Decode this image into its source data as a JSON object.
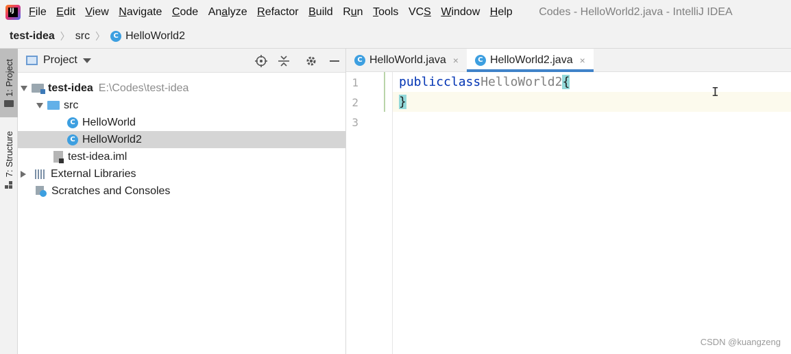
{
  "menubar": {
    "items": [
      {
        "label": "File",
        "mnemonic_index": 0
      },
      {
        "label": "Edit",
        "mnemonic_index": 0
      },
      {
        "label": "View",
        "mnemonic_index": 0
      },
      {
        "label": "Navigate",
        "mnemonic_index": 0
      },
      {
        "label": "Code",
        "mnemonic_index": 0
      },
      {
        "label": "Analyze",
        "mnemonic_index": 2
      },
      {
        "label": "Refactor",
        "mnemonic_index": 0
      },
      {
        "label": "Build",
        "mnemonic_index": 0
      },
      {
        "label": "Run",
        "mnemonic_index": 1
      },
      {
        "label": "Tools",
        "mnemonic_index": 0
      },
      {
        "label": "VCS",
        "mnemonic_index": 2
      },
      {
        "label": "Window",
        "mnemonic_index": 0
      },
      {
        "label": "Help",
        "mnemonic_index": 0
      }
    ],
    "window_title": "Codes - HelloWorld2.java - IntelliJ IDEA"
  },
  "breadcrumb": {
    "project": "test-idea",
    "folder": "src",
    "file": "HelloWorld2",
    "file_icon_letter": "C"
  },
  "left_strip": {
    "project_tab": "1: Project",
    "structure_tab": "7: Structure"
  },
  "project_panel": {
    "title": "Project",
    "tree": {
      "root_label": "test-idea",
      "root_path": "E:\\Codes\\test-idea",
      "src_label": "src",
      "file1_label": "HelloWorld",
      "file2_label": "HelloWorld2",
      "iml_label": "test-idea.iml",
      "libraries_label": "External Libraries",
      "scratches_label": "Scratches and Consoles",
      "class_icon_letter": "C"
    }
  },
  "editor": {
    "tabs": [
      {
        "label": "HelloWorld.java",
        "close": "×"
      },
      {
        "label": "HelloWorld2.java",
        "close": "×"
      }
    ],
    "line_numbers": [
      "1",
      "2",
      "3"
    ],
    "code": {
      "kw_public": "public",
      "kw_class": "class",
      "class_name": "HelloWorld2",
      "open_brace": "{",
      "close_brace": "}"
    },
    "cursor_glyph": "I"
  },
  "watermark": "CSDN @kuangzeng",
  "colors": {
    "keyword": "#0033b3",
    "class_name": "#808080",
    "brace_highlight": "#93d9d9",
    "selection": "#d5d5d5",
    "active_tab_underline": "#4083c9"
  }
}
